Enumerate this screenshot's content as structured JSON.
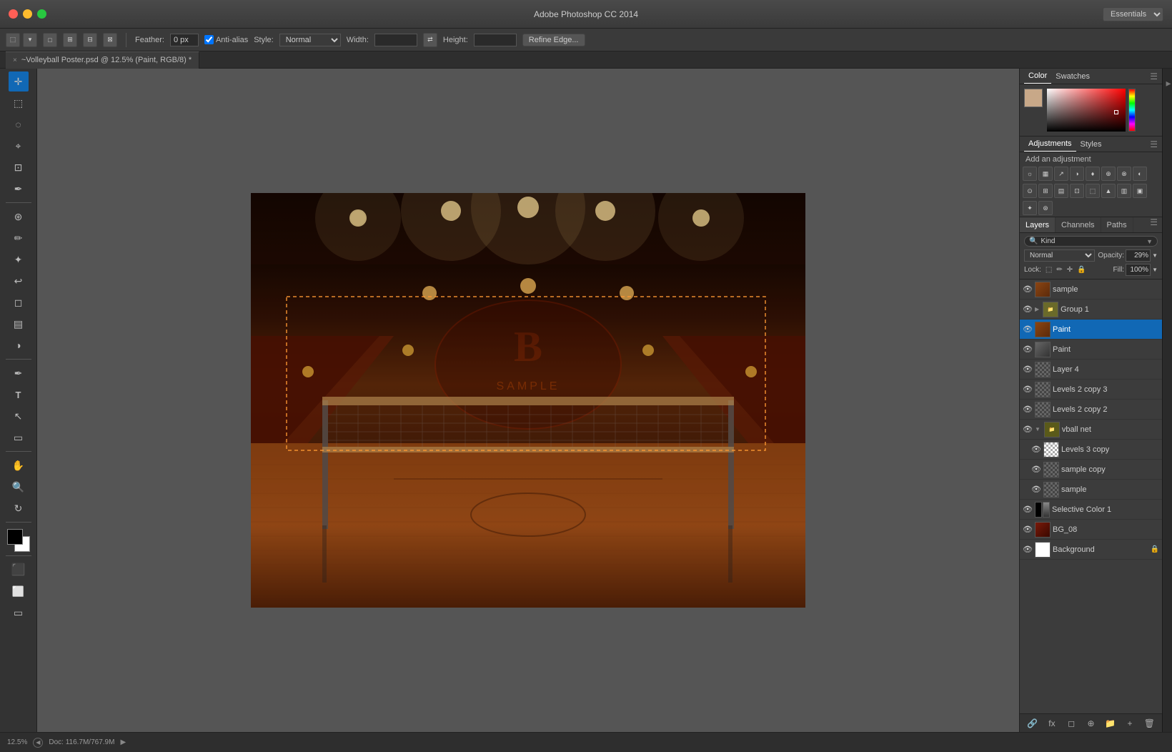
{
  "titleBar": {
    "title": "Adobe Photoshop CC 2014",
    "essentials": "Essentials"
  },
  "toolbar": {
    "feather_label": "Feather:",
    "feather_value": "0 px",
    "anti_alias_label": "Anti-alias",
    "style_label": "Style:",
    "style_value": "Normal",
    "width_label": "Width:",
    "height_label": "Height:",
    "refine_edge": "Refine Edge..."
  },
  "tab": {
    "close": "×",
    "name": "~Volleyball Poster.psd @ 12.5% (Paint, RGB/8) *"
  },
  "colorPanel": {
    "color_tab": "Color",
    "swatches_tab": "Swatches"
  },
  "adjustments": {
    "title": "Add an adjustment",
    "tabs": {
      "adjustments": "Adjustments",
      "styles": "Styles"
    }
  },
  "layers": {
    "layers_tab": "Layers",
    "channels_tab": "Channels",
    "paths_tab": "Paths",
    "search_placeholder": "Kind",
    "blend_mode": "Normal",
    "opacity_label": "Opacity:",
    "opacity_value": "29%",
    "lock_label": "Lock:",
    "fill_label": "Fill:",
    "fill_value": "100%",
    "items": [
      {
        "name": "sample",
        "visible": true,
        "selected": false,
        "thumb": "brown",
        "indent": false,
        "group": false,
        "has_arrow": false
      },
      {
        "name": "Group 1",
        "visible": true,
        "selected": false,
        "thumb": "folder",
        "indent": false,
        "group": true,
        "has_arrow": true
      },
      {
        "name": "Paint",
        "visible": true,
        "selected": true,
        "thumb": "brown",
        "indent": false,
        "group": false,
        "has_arrow": false
      },
      {
        "name": "Paint",
        "visible": true,
        "selected": false,
        "thumb": "gray",
        "indent": false,
        "group": false,
        "has_arrow": false
      },
      {
        "name": "Layer 4",
        "visible": true,
        "selected": false,
        "thumb": "checker",
        "indent": false,
        "group": false,
        "has_arrow": false
      },
      {
        "name": "Levels 2 copy 3",
        "visible": true,
        "selected": false,
        "thumb": "checker",
        "indent": false,
        "group": false,
        "has_arrow": false
      },
      {
        "name": "Levels 2 copy 2",
        "visible": true,
        "selected": false,
        "thumb": "checker",
        "indent": false,
        "group": false,
        "has_arrow": false
      },
      {
        "name": "vball net",
        "visible": true,
        "selected": false,
        "thumb": "folder",
        "indent": false,
        "group": true,
        "has_arrow": true,
        "expanded": true
      },
      {
        "name": "Levels 3 copy",
        "visible": true,
        "selected": false,
        "thumb": "checker-white",
        "indent": true,
        "group": false,
        "has_arrow": false
      },
      {
        "name": "sample copy",
        "visible": true,
        "selected": false,
        "thumb": "checker",
        "indent": true,
        "group": false,
        "has_arrow": false
      },
      {
        "name": "sample",
        "visible": true,
        "selected": false,
        "thumb": "checker",
        "indent": true,
        "group": false,
        "has_arrow": false
      },
      {
        "name": "Selective Color 1",
        "visible": true,
        "selected": false,
        "thumb": "adjustment",
        "indent": false,
        "group": false,
        "has_arrow": false
      },
      {
        "name": "BG_08",
        "visible": true,
        "selected": false,
        "thumb": "red-brown",
        "indent": false,
        "group": false,
        "has_arrow": false
      },
      {
        "name": "Background",
        "visible": true,
        "selected": false,
        "thumb": "white",
        "indent": false,
        "group": false,
        "has_arrow": false,
        "locked": true
      }
    ]
  },
  "statusBar": {
    "zoom": "12.5%",
    "doc_info": "Doc: 116.7M/767.9M"
  }
}
